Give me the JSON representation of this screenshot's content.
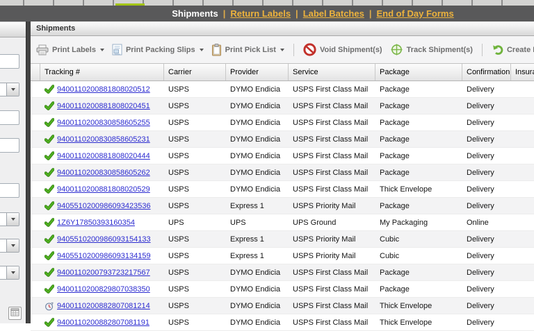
{
  "colors": {
    "accent_gold": "#ECB23D",
    "active_tab_green": "#A3C511",
    "check_green": "#4FAE1F",
    "void_red": "#C2312B",
    "track_green": "#7AB648",
    "link_blue": "#2B2BD0",
    "navbar_bg": "#59595A"
  },
  "nav": {
    "separator": "|",
    "items": [
      {
        "label": "Shipments",
        "active": true
      },
      {
        "label": "Return Labels",
        "active": false
      },
      {
        "label": "Label Batches",
        "active": false
      },
      {
        "label": "End of Day Forms",
        "active": false
      }
    ]
  },
  "panel": {
    "title": "Shipments"
  },
  "toolbar": {
    "buttons": [
      {
        "label": "Print Labels",
        "icon": "printer-icon",
        "dropdown": true
      },
      {
        "label": "Print Packing Slips",
        "icon": "packing-slip-icon",
        "dropdown": true
      },
      {
        "label": "Print Pick List",
        "icon": "clipboard-icon",
        "dropdown": true,
        "separator_after": true
      },
      {
        "label": "Void Shipment(s)",
        "icon": "void-icon"
      },
      {
        "label": "Track Shipment(s)",
        "icon": "track-icon",
        "separator_after": true
      },
      {
        "label": "Create Return",
        "icon": "return-icon"
      }
    ]
  },
  "table": {
    "columns": [
      "Tracking #",
      "Carrier",
      "Provider",
      "Service",
      "Package",
      "Confirmation",
      "Insurance"
    ],
    "rows": [
      {
        "status": "ok",
        "tracking": "9400110200881808020512",
        "carrier": "USPS",
        "provider": "DYMO Endicia",
        "service": "USPS First Class Mail",
        "package": "Package",
        "confirmation": "Delivery",
        "insurance": ""
      },
      {
        "status": "ok",
        "tracking": "9400110200881808020451",
        "carrier": "USPS",
        "provider": "DYMO Endicia",
        "service": "USPS First Class Mail",
        "package": "Package",
        "confirmation": "Delivery",
        "insurance": ""
      },
      {
        "status": "ok",
        "tracking": "9400110200830858605255",
        "carrier": "USPS",
        "provider": "DYMO Endicia",
        "service": "USPS First Class Mail",
        "package": "Package",
        "confirmation": "Delivery",
        "insurance": ""
      },
      {
        "status": "ok",
        "tracking": "9400110200830858605231",
        "carrier": "USPS",
        "provider": "DYMO Endicia",
        "service": "USPS First Class Mail",
        "package": "Package",
        "confirmation": "Delivery",
        "insurance": ""
      },
      {
        "status": "ok",
        "tracking": "9400110200881808020444",
        "carrier": "USPS",
        "provider": "DYMO Endicia",
        "service": "USPS First Class Mail",
        "package": "Package",
        "confirmation": "Delivery",
        "insurance": ""
      },
      {
        "status": "ok",
        "tracking": "9400110200830858605262",
        "carrier": "USPS",
        "provider": "DYMO Endicia",
        "service": "USPS First Class Mail",
        "package": "Package",
        "confirmation": "Delivery",
        "insurance": ""
      },
      {
        "status": "ok",
        "tracking": "9400110200881808020529",
        "carrier": "USPS",
        "provider": "DYMO Endicia",
        "service": "USPS First Class Mail",
        "package": "Thick Envelope",
        "confirmation": "Delivery",
        "insurance": ""
      },
      {
        "status": "ok",
        "tracking": "9405510200986093423536",
        "carrier": "USPS",
        "provider": "Express 1",
        "service": "USPS Priority Mail",
        "package": "Package",
        "confirmation": "Delivery",
        "insurance": ""
      },
      {
        "status": "ok",
        "tracking": "1Z6Y17850393160354",
        "carrier": "UPS",
        "provider": "UPS",
        "service": "UPS Ground",
        "package": "My Packaging",
        "confirmation": "Online",
        "insurance": ""
      },
      {
        "status": "ok",
        "tracking": "9405510200986093154133",
        "carrier": "USPS",
        "provider": "Express 1",
        "service": "USPS Priority Mail",
        "package": "Cubic",
        "confirmation": "Delivery",
        "insurance": ""
      },
      {
        "status": "ok",
        "tracking": "9405510200986093134159",
        "carrier": "USPS",
        "provider": "Express 1",
        "service": "USPS Priority Mail",
        "package": "Cubic",
        "confirmation": "Delivery",
        "insurance": ""
      },
      {
        "status": "ok",
        "tracking": "9400110200793723217567",
        "carrier": "USPS",
        "provider": "DYMO Endicia",
        "service": "USPS First Class Mail",
        "package": "Package",
        "confirmation": "Delivery",
        "insurance": ""
      },
      {
        "status": "ok",
        "tracking": "9400110200829807038350",
        "carrier": "USPS",
        "provider": "DYMO Endicia",
        "service": "USPS First Class Mail",
        "package": "Package",
        "confirmation": "Delivery",
        "insurance": ""
      },
      {
        "status": "pending",
        "tracking": "9400110200882807081214",
        "carrier": "USPS",
        "provider": "DYMO Endicia",
        "service": "USPS First Class Mail",
        "package": "Thick Envelope",
        "confirmation": "Delivery",
        "insurance": ""
      },
      {
        "status": "ok",
        "tracking": "9400110200882807081191",
        "carrier": "USPS",
        "provider": "DYMO Endicia",
        "service": "USPS First Class Mail",
        "package": "Thick Envelope",
        "confirmation": "Delivery",
        "insurance": ""
      }
    ]
  }
}
